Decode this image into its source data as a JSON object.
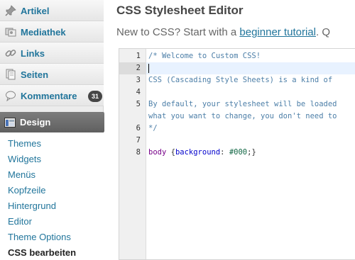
{
  "sidebar": {
    "items": [
      {
        "label": "Artikel",
        "icon": "pin-icon"
      },
      {
        "label": "Mediathek",
        "icon": "media-icon"
      },
      {
        "label": "Links",
        "icon": "link-icon"
      },
      {
        "label": "Seiten",
        "icon": "pages-icon"
      },
      {
        "label": "Kommentare",
        "icon": "comment-icon",
        "badge": "31"
      }
    ],
    "design": {
      "label": "Design",
      "icon": "appearance-icon"
    },
    "submenu": [
      "Themes",
      "Widgets",
      "Menüs",
      "Kopfzeile",
      "Hintergrund",
      "Editor",
      "Theme Options",
      "CSS bearbeiten"
    ],
    "current_submenu": "CSS bearbeiten"
  },
  "main": {
    "title": "CSS Stylesheet Editor",
    "intro_prefix": "New to CSS? Start with a ",
    "intro_link": "beginner tutorial",
    "intro_suffix": ". Q"
  },
  "editor": {
    "active_line": 2,
    "line_numbers": [
      "1",
      "2",
      "3",
      "4",
      "5",
      "",
      "6",
      "7",
      "8"
    ],
    "lines": {
      "l1": "/* Welcome to Custom CSS!",
      "l2": "",
      "l3": "CSS (Cascading Style Sheets) is a kind of",
      "l4": "",
      "l5a": "By default, your stylesheet will be loaded",
      "l5b": "what you want to change, you don't need to",
      "l6": "*/",
      "l7": "",
      "l8_selector": "body",
      "l8_open": " {",
      "l8_property": "background",
      "l8_colon": ": ",
      "l8_value": "#000",
      "l8_close": ";}"
    }
  },
  "colors": {
    "link": "#21759b",
    "menu_active_bg": "#6b6b6b",
    "badge_bg": "#464646",
    "comment": "#4d7fa8"
  }
}
